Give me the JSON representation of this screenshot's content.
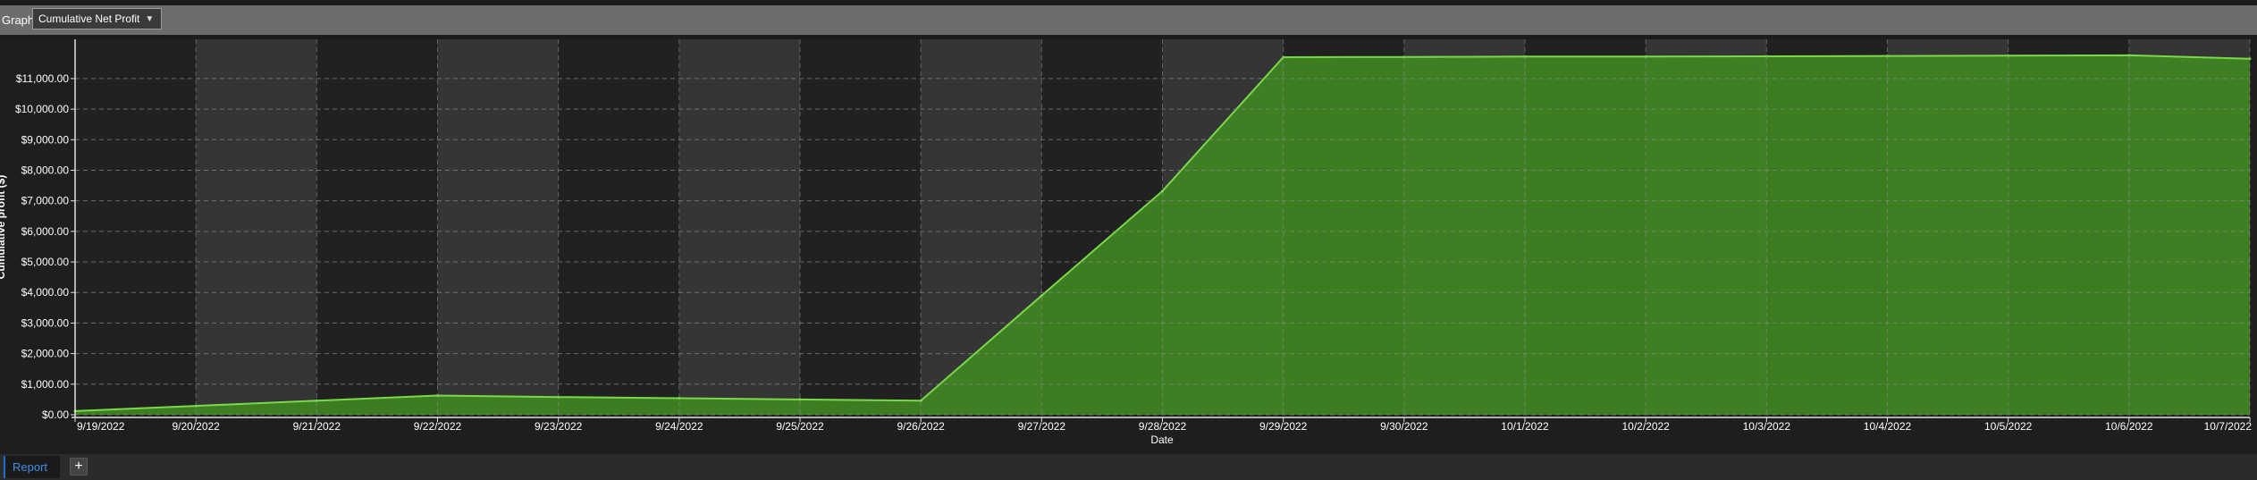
{
  "toolbar": {
    "graph_label": "Graph",
    "graph_select_value": "Cumulative Net Profit",
    "chevron_icon": "chevron-down-icon"
  },
  "tabs": {
    "report_label": "Report",
    "add_label": "+"
  },
  "colors": {
    "plot_bg_dark": "#212121",
    "plot_bg_band": "#353535",
    "area_fill": "#3f8622",
    "area_line": "#7ad84a",
    "grid": "#8a8a8a",
    "accent_tab": "#1e6fd0"
  },
  "chart_data": {
    "type": "area",
    "x": [
      "9/19/2022",
      "9/20/2022",
      "9/21/2022",
      "9/22/2022",
      "9/23/2022",
      "9/24/2022",
      "9/25/2022",
      "9/26/2022",
      "9/27/2022",
      "9/28/2022",
      "9/29/2022",
      "9/30/2022",
      "10/1/2022",
      "10/2/2022",
      "10/3/2022",
      "10/4/2022",
      "10/5/2022",
      "10/6/2022",
      "10/7/2022"
    ],
    "values": [
      120,
      290,
      460,
      630,
      580,
      540,
      500,
      460,
      3900,
      7320,
      11700,
      11710,
      11720,
      11720,
      11730,
      11740,
      11750,
      11760,
      11650
    ],
    "xlabel": "Date",
    "ylabel": "Cumulative profit ($)",
    "ylim": [
      0,
      11700
    ],
    "yticks": [
      0,
      1000,
      2000,
      3000,
      4000,
      5000,
      6000,
      7000,
      8000,
      9000,
      10000,
      11000
    ],
    "ytick_labels": [
      "$0.00",
      "$1,000.00",
      "$2,000.00",
      "$3,000.00",
      "$4,000.00",
      "$5,000.00",
      "$6,000.00",
      "$7,000.00",
      "$8,000.00",
      "$9,000.00",
      "$10,000.00",
      "$11,000.00"
    ],
    "grid": true,
    "legend": "none"
  }
}
